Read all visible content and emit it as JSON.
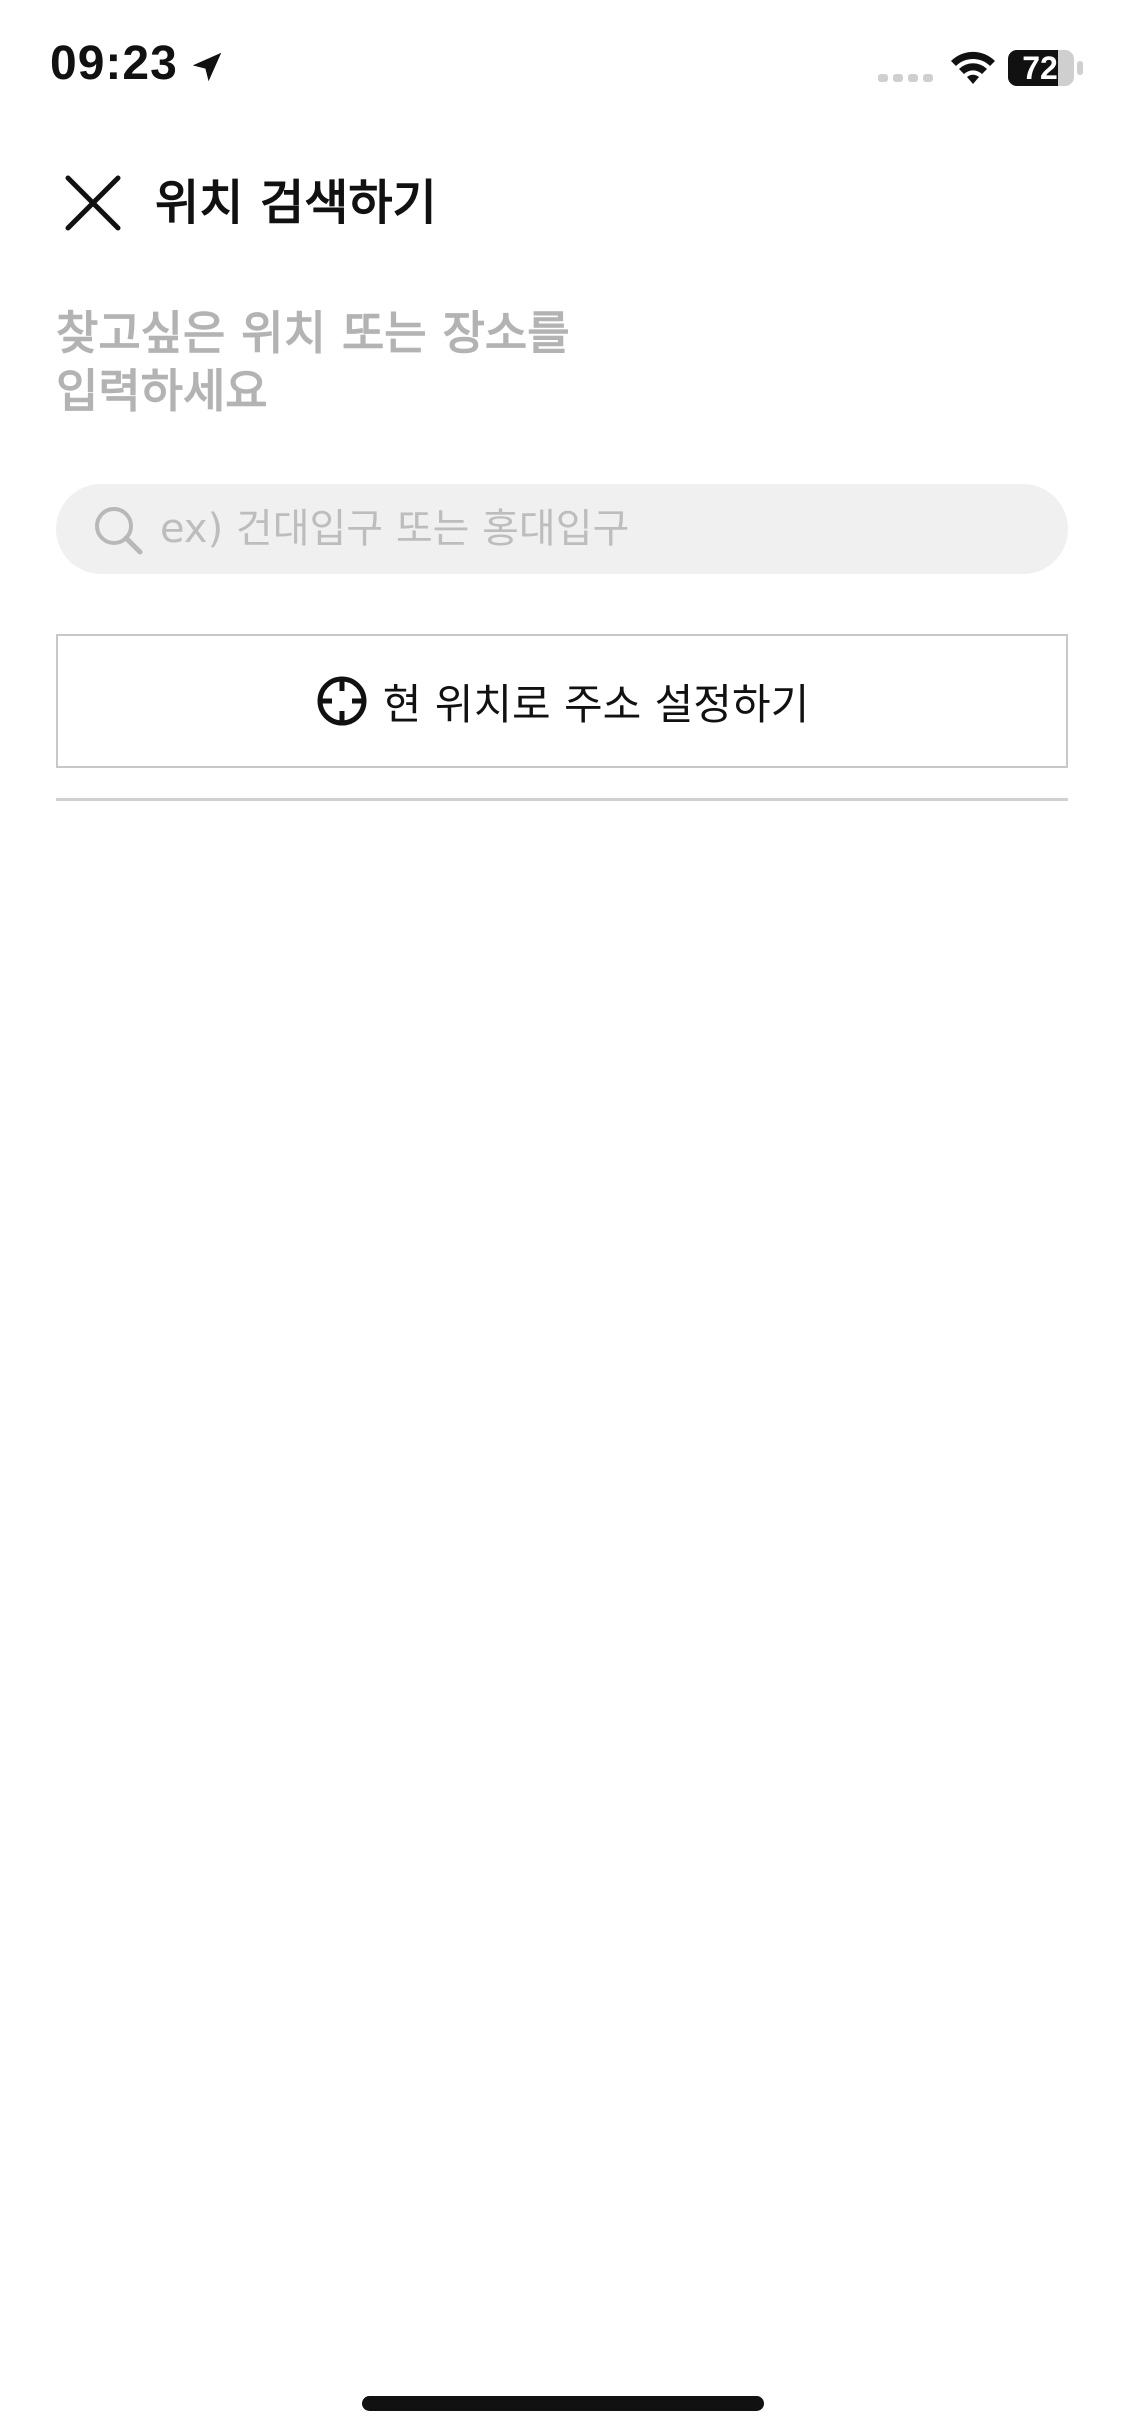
{
  "status_bar": {
    "time": "09:23",
    "battery_level": "72",
    "icons": [
      "location-arrow-icon",
      "cellular-signal-icon",
      "wifi-icon",
      "battery-icon"
    ]
  },
  "header": {
    "title": "위치 검색하기",
    "close_icon": "close-icon"
  },
  "prompt": {
    "line1": "찾고싶은 위치 또는 장소를",
    "line2": "입력하세요"
  },
  "search": {
    "placeholder": "ex) 건대입구 또는 홍대입구",
    "value": "",
    "icon": "search-icon"
  },
  "current_location": {
    "label": "현 위치로 주소 설정하기",
    "icon": "crosshair-icon"
  },
  "colors": {
    "text": "#111111",
    "muted": "#b3b3b3",
    "search_bg": "#f0f0f0",
    "border": "#c8c8c8"
  }
}
